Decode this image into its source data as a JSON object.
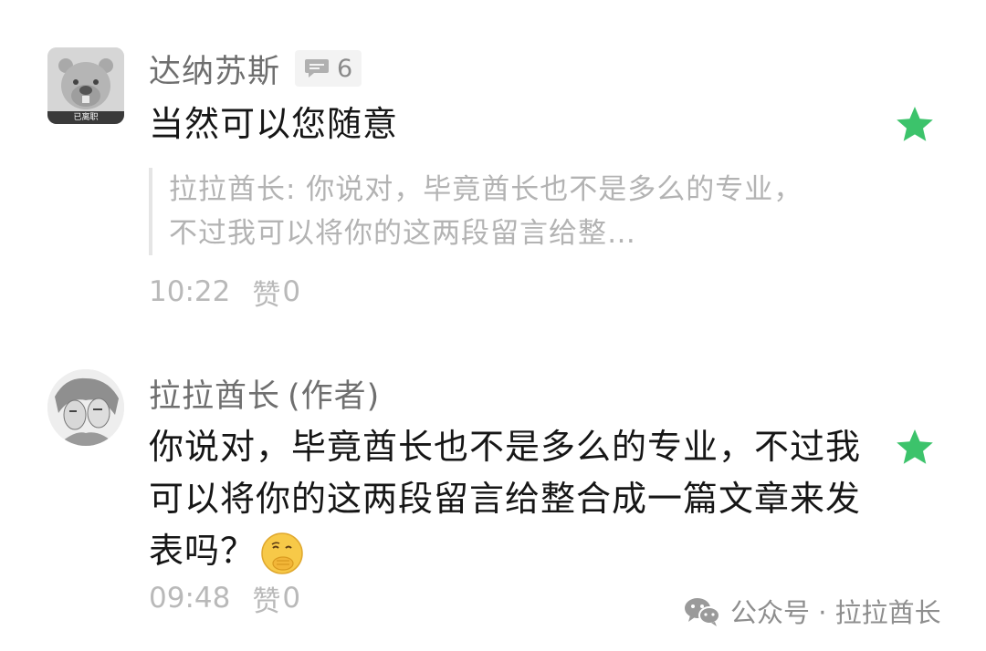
{
  "comments": [
    {
      "name": "达纳苏斯",
      "reply_count": "6",
      "avatar_caption": "已离职",
      "text": "当然可以您随意",
      "quote": "拉拉酋长: 你说对，毕竟酋长也不是多么的专业，不过我可以将你的这两段留言给整…",
      "time": "10:22",
      "like_label": "赞",
      "like_count": "0",
      "starred": true,
      "icons": {
        "avatar": "beaver-avatar",
        "reply": "comment-bubble-icon",
        "star": "star-icon"
      }
    },
    {
      "name": "拉拉酋长",
      "author_tag": "(作者)",
      "text": "你说对，毕竟酋长也不是多么的专业，不过我可以将你的这两段留言给整合成一篇文章来发表吗？",
      "time": "09:48",
      "like_label": "赞",
      "like_count": "0",
      "starred": true,
      "icons": {
        "avatar": "sketch-portrait-avatar",
        "emoji": "thinking-face-emoji",
        "star": "star-icon"
      }
    }
  ],
  "watermark": {
    "text": "公众号 · 拉拉酋长",
    "icon": "wechat-icon"
  },
  "colors": {
    "star": "#3cc36b",
    "name": "#6f6f6f",
    "meta": "#b9b9b9",
    "quote": "#b3b3b3"
  }
}
